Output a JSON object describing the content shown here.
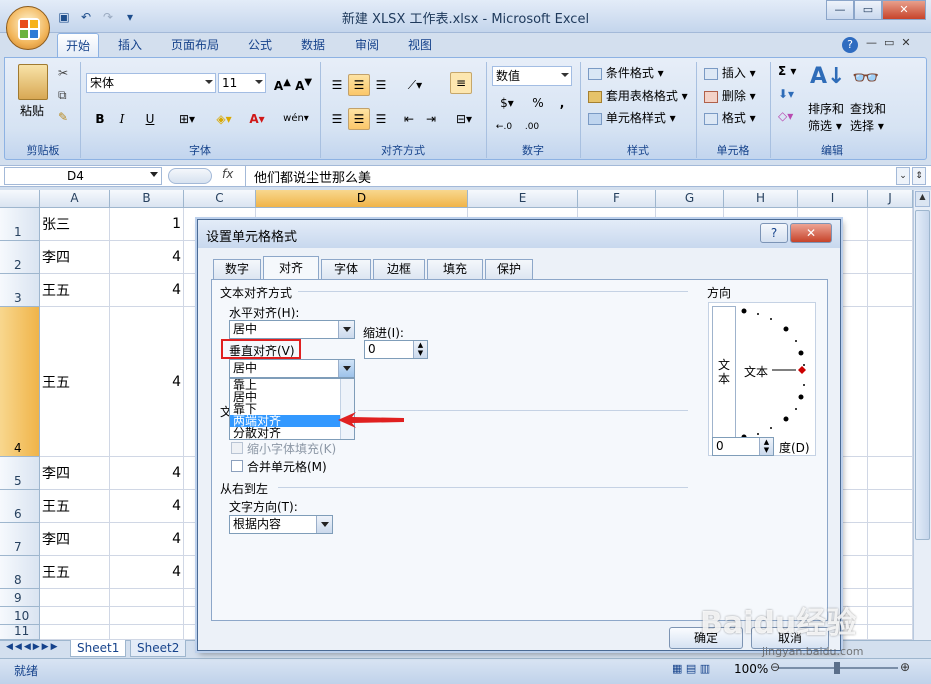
{
  "window": {
    "title": "新建 XLSX 工作表.xlsx - Microsoft Excel"
  },
  "tabs": [
    "开始",
    "插入",
    "页面布局",
    "公式",
    "数据",
    "审阅",
    "视图"
  ],
  "ribbon": {
    "clipboard": {
      "label": "剪贴板",
      "paste": "粘贴"
    },
    "font": {
      "label": "字体",
      "name": "宋体",
      "size": "11",
      "bold": "B",
      "italic": "I",
      "underline": "U",
      "font_color": "A",
      "wen": "wén 文"
    },
    "alignment": {
      "label": "对齐方式"
    },
    "number": {
      "label": "数字",
      "format": "数值",
      "percent": "%",
      "comma": ",",
      "inc": "+.0 .00",
      "dec": ".00 +.0"
    },
    "styles": {
      "label": "样式",
      "cond": "条件格式",
      "table": "套用表格格式",
      "cell": "单元格样式"
    },
    "cells": {
      "label": "单元格",
      "insert": "插入",
      "delete": "删除",
      "format": "格式"
    },
    "editing": {
      "label": "编辑",
      "sigma": "Σ",
      "sort": "排序和\n筛选",
      "sort1": "排序和",
      "sort2": "筛选",
      "find1": "查找和",
      "find2": "选择"
    }
  },
  "formula_bar": {
    "name_box": "D4",
    "fx": "fx",
    "content": "他们都说尘世那么美"
  },
  "columns": [
    "A",
    "B",
    "C",
    "D",
    "E",
    "F",
    "G",
    "H",
    "I",
    "J"
  ],
  "rows": [
    {
      "num": "1",
      "a": "张三",
      "b": "1"
    },
    {
      "num": "2",
      "a": "李四",
      "b": "4"
    },
    {
      "num": "3",
      "a": "王五",
      "b": "4"
    },
    {
      "num": "4",
      "a": "王五",
      "b": "4"
    },
    {
      "num": "5",
      "a": "李四",
      "b": "4"
    },
    {
      "num": "6",
      "a": "王五",
      "b": "4"
    },
    {
      "num": "7",
      "a": "李四",
      "b": "4"
    },
    {
      "num": "8",
      "a": "王五",
      "b": "4"
    },
    {
      "num": "9",
      "a": "",
      "b": ""
    },
    {
      "num": "10",
      "a": "",
      "b": ""
    },
    {
      "num": "11",
      "a": "",
      "b": ""
    }
  ],
  "sheet_tabs": [
    "Sheet1",
    "Sheet2"
  ],
  "status": {
    "ready": "就绪",
    "zoom": "100%"
  },
  "dialog": {
    "title": "设置单元格格式",
    "help": "?",
    "close": "✕",
    "tabs": [
      "数字",
      "对齐",
      "字体",
      "边框",
      "填充",
      "保护"
    ],
    "text_align_section": "文本对齐方式",
    "horizontal_label": "水平对齐(H):",
    "horizontal_value": "居中",
    "indent_label": "缩进(I):",
    "indent_value": "0",
    "vertical_label": "垂直对齐(V)",
    "vertical_value": "居中",
    "vertical_options": [
      "靠上",
      "居中",
      "靠下",
      "两端对齐",
      "分散对齐"
    ],
    "text_control_section": "文本控制",
    "shrink": "缩小字体填充(K)",
    "merge": "合并单元格(M)",
    "rtl_section": "从右到左",
    "text_dir_label": "文字方向(T):",
    "text_dir_value": "根据内容",
    "orientation_section": "方向",
    "orientation_vtext": "文\n本",
    "orientation_v1": "文",
    "orientation_v2": "本",
    "orientation_htext": "文本",
    "degree_value": "0",
    "degree_label": "度(D)",
    "ok": "确定",
    "cancel": "取消"
  },
  "watermark": {
    "text": "Baidu经验",
    "url": "jingyan.baidu.com"
  },
  "colors": {
    "highlight": "#e02020",
    "selected_item": "#3399ff"
  }
}
